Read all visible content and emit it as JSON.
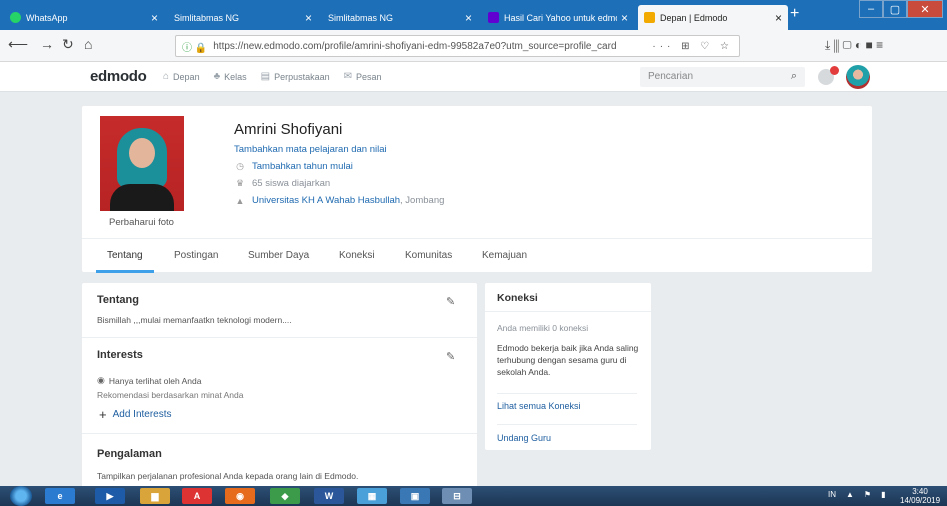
{
  "browser": {
    "tabs": [
      {
        "label": "WhatsApp",
        "favicon_color": "#25d366"
      },
      {
        "label": "Simlitabmas NG",
        "favicon_color": ""
      },
      {
        "label": "Simlitabmas NG",
        "favicon_color": ""
      },
      {
        "label": "Hasil Cari Yahoo untuk edmodo",
        "favicon_color": "#6001d2"
      },
      {
        "label": "Depan | Edmodo",
        "favicon_color": "#f2a900",
        "active": true
      }
    ],
    "new_tab": "+",
    "url": "https://new.edmodo.com/profile/amrini-shofiyani-edm-99582a7e0?utm_source=profile_card",
    "url_extras": "··· ⊞ ♡ ☆",
    "toolbar_icons": "⤓  ⫼  ▢  ◐  ■  ≡"
  },
  "edmodo": {
    "logo": "edmodo",
    "nav": [
      {
        "label": "Depan",
        "icon": "home-icon",
        "glyph": "⌂"
      },
      {
        "label": "Kelas",
        "icon": "class-icon",
        "glyph": "♣"
      },
      {
        "label": "Perpustakaan",
        "icon": "library-icon",
        "glyph": "▤"
      },
      {
        "label": "Pesan",
        "icon": "message-icon",
        "glyph": "✉"
      }
    ],
    "search_placeholder": "Pencarian"
  },
  "profile": {
    "name": "Amrini Shofiyani",
    "add_subjects": "Tambahkan mata pelajaran dan nilai",
    "add_year": "Tambahkan tahun mulai",
    "students": "65 siswa diajarkan",
    "university": "Universitas KH A Wahab Hasbullah",
    "city": ", Jombang",
    "update_photo": "Perbaharui foto",
    "tabs": [
      "Tentang",
      "Postingan",
      "Sumber Daya",
      "Koneksi",
      "Komunitas",
      "Kemajuan"
    ]
  },
  "about": {
    "tentang_title": "Tentang",
    "tentang_text": "Bismillah ,,,mulai memanfaatkn teknologi modern....",
    "interests_title": "Interests",
    "visibility": "Hanya terlihat oleh Anda",
    "recommendation": "Rekomendasi berdasarkan minat Anda",
    "add_interests": "Add Interests",
    "pengalaman_title": "Pengalaman",
    "pengalaman_text": "Tampilkan perjalanan profesional Anda kepada orang lain di Edmodo."
  },
  "koneksi": {
    "title": "Koneksi",
    "count": "Anda memiliki 0 koneksi",
    "description": "Edmodo bekerja baik jika Anda saling terhubung dengan sesama guru di sekolah Anda.",
    "see_all": "Lihat semua Koneksi",
    "invite": "Undang Guru"
  },
  "taskbar": {
    "apps": [
      {
        "name": "ie",
        "label": "e",
        "color": "#2b7bd1"
      },
      {
        "name": "media",
        "label": "▶",
        "color": "#1d5aa8"
      },
      {
        "name": "explorer",
        "label": "▆",
        "color": "#d9a53a"
      },
      {
        "name": "pdf",
        "label": "A",
        "color": "#d33"
      },
      {
        "name": "firefox",
        "label": "◉",
        "color": "#e66b1c"
      },
      {
        "name": "app",
        "label": "◆",
        "color": "#3b9b4b"
      },
      {
        "name": "word",
        "label": "W",
        "color": "#2b579a"
      },
      {
        "name": "app2",
        "label": "▦",
        "color": "#4aa0d8"
      },
      {
        "name": "app3",
        "label": "▣",
        "color": "#3a78b5"
      },
      {
        "name": "app4",
        "label": "⊟",
        "color": "#6e8fb3"
      }
    ],
    "tray_lang": "IN",
    "time": "3:40",
    "date": "14/09/2019"
  }
}
